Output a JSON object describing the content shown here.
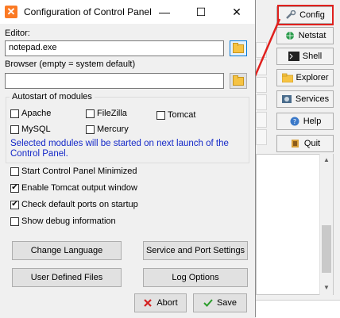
{
  "window": {
    "title": "Configuration of Control Panel",
    "minimize": "—",
    "maximize": "☐",
    "close": "✕"
  },
  "editor": {
    "label": "Editor:",
    "value": "notepad.exe"
  },
  "browser": {
    "label": "Browser (empty = system default)",
    "value": ""
  },
  "autostart": {
    "title": "Autostart of modules",
    "modules": [
      "Apache",
      "FileZilla",
      "Tomcat",
      "MySQL",
      "Mercury"
    ],
    "note": "Selected modules will be started on next launch of the Control Panel."
  },
  "options": [
    {
      "label": "Start Control Panel Minimized",
      "checked": false
    },
    {
      "label": "Enable Tomcat output window",
      "checked": true
    },
    {
      "label": "Check default ports on startup",
      "checked": true
    },
    {
      "label": "Show debug information",
      "checked": false
    }
  ],
  "buttons": {
    "change_language": "Change Language",
    "service_port": "Service and Port Settings",
    "user_files": "User Defined Files",
    "log_options": "Log Options",
    "abort": "Abort",
    "save": "Save"
  },
  "sidebar": {
    "items": [
      {
        "label": "Config",
        "icon": "wrench-icon"
      },
      {
        "label": "Netstat",
        "icon": "globe-icon"
      },
      {
        "label": "Shell",
        "icon": "terminal-icon"
      },
      {
        "label": "Explorer",
        "icon": "folder-icon"
      },
      {
        "label": "Services",
        "icon": "services-icon"
      },
      {
        "label": "Help",
        "icon": "help-icon"
      },
      {
        "label": "Quit",
        "icon": "quit-icon"
      }
    ]
  },
  "colors": {
    "annotation": "#e0201d",
    "note_text": "#1428c8",
    "accent": "#0078d7"
  }
}
